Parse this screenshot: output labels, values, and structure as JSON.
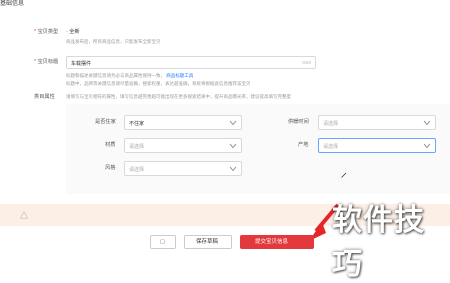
{
  "section": {
    "title": "基础信息"
  },
  "fields": {
    "type": {
      "label": "宝贝类型",
      "required_mark": "*",
      "value": "全新",
      "radio_prefix": "◦",
      "hint": "商品发布后，所有商品信息，只能发布全新宝贝"
    },
    "title": {
      "label": "宝贝标题",
      "required_mark": "*",
      "value": "车载摆件",
      "counter": "8/60",
      "hint": "标题和描述关键信息请务必与商品属性保持一致，",
      "hint_link": "商品标题工具",
      "hint2": "标题中，品牌等关键信息请尽量准确，搜索权重，表达越准确，系统将根据此信息推荐该宝贝"
    },
    "attrs": {
      "label": "类目属性",
      "hint": "请填写与宝贝相符的属性，填写信息越完善越可能出现在更多搜索结果中，提升商品曝光率，建议提高填写完整度"
    }
  },
  "attributes": [
    {
      "label": "是否住家",
      "value": "不住家",
      "filled": true
    },
    {
      "label": "供暖时间",
      "value": "请选择",
      "filled": false
    },
    {
      "label": "材质",
      "value": "请选择",
      "filled": false
    },
    {
      "label": "产地",
      "value": "请选择",
      "filled": false
    },
    {
      "label": "风格",
      "value": "请选择",
      "filled": false
    }
  ],
  "warning": {
    "icon": "warning-icon"
  },
  "footer": {
    "btn1": "▢",
    "btn2": "保存草稿",
    "btn3": "提交宝贝信息"
  },
  "watermark": "软件技巧"
}
